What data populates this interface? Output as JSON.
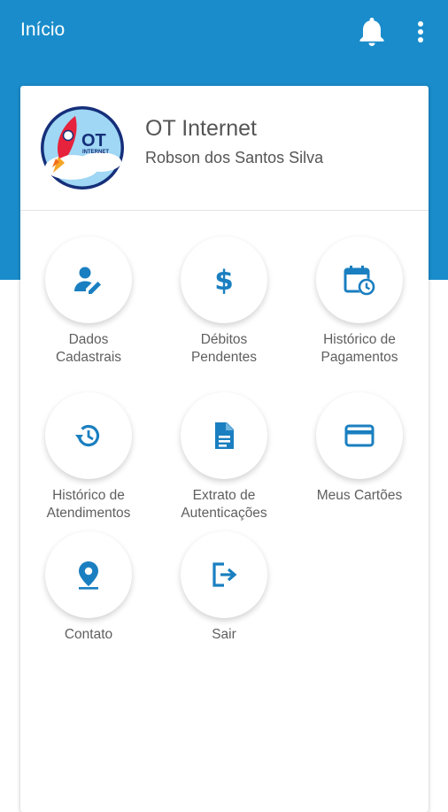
{
  "app_bar": {
    "title": "Início",
    "icons": [
      "bell-icon",
      "more-vertical-icon"
    ]
  },
  "profile": {
    "company": "OT Internet",
    "user_name": "Robson dos Santos Silva",
    "logo": {
      "text_top": "OT",
      "text_bottom": "INTERNET"
    }
  },
  "menu": [
    {
      "label": "Dados\nCadastrais",
      "icon": "user-edit-icon"
    },
    {
      "label": "Débitos\nPendentes",
      "icon": "dollar-icon"
    },
    {
      "label": "Histórico de\nPagamentos",
      "icon": "calendar-clock-icon"
    },
    {
      "label": "Histórico de\nAtendimentos",
      "icon": "history-icon"
    },
    {
      "label": "Extrato de\nAutenticações",
      "icon": "document-icon"
    },
    {
      "label": "Meus Cartões",
      "icon": "credit-card-icon"
    },
    {
      "label": "Contato",
      "icon": "location-pin-icon"
    },
    {
      "label": "Sair",
      "icon": "logout-icon"
    }
  ],
  "colors": {
    "primary": "#1a8ccb",
    "icon": "#1a7fc0",
    "text": "#5f5f5f"
  }
}
